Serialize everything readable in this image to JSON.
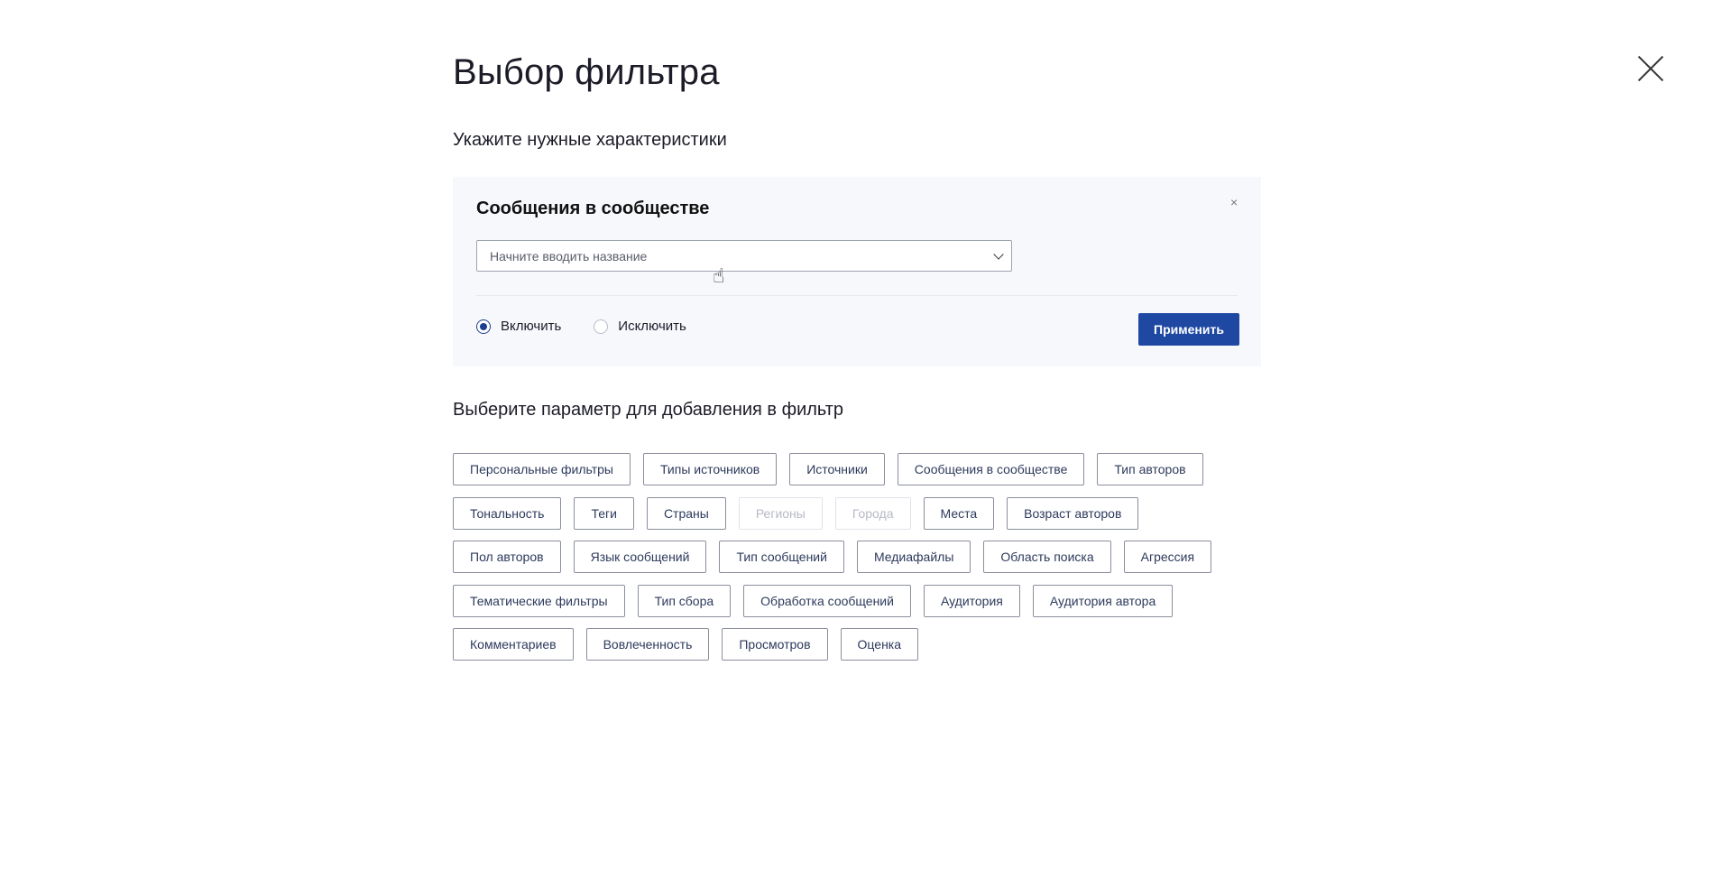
{
  "title": "Выбор фильтра",
  "subtitle": "Укажите нужные характеристики",
  "panel": {
    "title": "Сообщения в сообществе",
    "close_label": "×",
    "select_placeholder": "Начните вводить название",
    "include_label": "Включить",
    "exclude_label": "Исключить",
    "selected_mode": "include",
    "apply_label": "Применить"
  },
  "section_title": "Выберите параметр для добавления в фильтр",
  "chip_rows": [
    [
      {
        "label": "Персональные фильтры"
      },
      {
        "label": "Типы источников"
      },
      {
        "label": "Источники"
      },
      {
        "label": "Сообщения в сообществе"
      },
      {
        "label": "Тип авторов"
      }
    ],
    [
      {
        "label": "Тональность"
      },
      {
        "label": "Теги"
      },
      {
        "label": "Страны"
      },
      {
        "label": "Регионы",
        "disabled": true
      },
      {
        "label": "Города",
        "disabled": true
      },
      {
        "label": "Места"
      },
      {
        "label": "Возраст авторов"
      }
    ],
    [
      {
        "label": "Пол авторов"
      },
      {
        "label": "Язык сообщений"
      },
      {
        "label": "Тип сообщений"
      },
      {
        "label": "Медиафайлы"
      },
      {
        "label": "Область поиска"
      },
      {
        "label": "Агрессия"
      }
    ],
    [
      {
        "label": "Тематические фильтры"
      },
      {
        "label": "Тип сбора"
      },
      {
        "label": "Обработка сообщений"
      },
      {
        "label": "Аудитория"
      },
      {
        "label": "Аудитория автора"
      }
    ],
    [
      {
        "label": "Комментариев"
      },
      {
        "label": "Вовлеченность"
      },
      {
        "label": "Просмотров"
      },
      {
        "label": "Оценка"
      }
    ]
  ],
  "colors": {
    "primary": "#1f48a3",
    "panel_bg": "#f7f8fc",
    "chip_border": "#8a8f9c",
    "chip_text": "#2d3a5c",
    "disabled": "#b7bac4"
  }
}
